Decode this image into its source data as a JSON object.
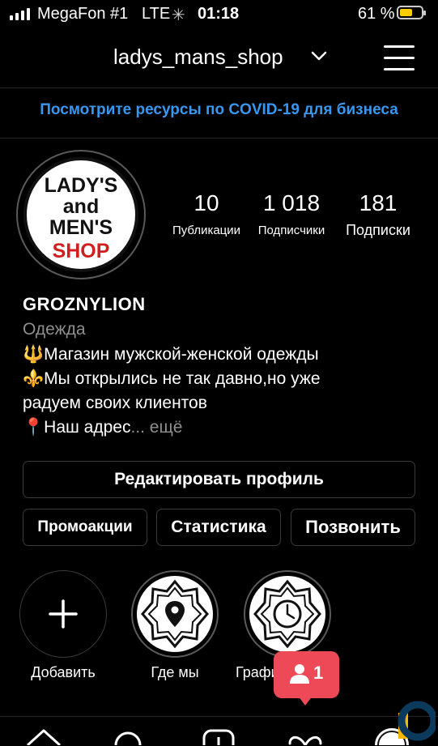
{
  "status_bar": {
    "carrier": "MegaFon #1",
    "network": "LTE",
    "time": "01:18",
    "battery_percent": "61 %",
    "battery_level": 0.61,
    "battery_color": "#ffcc00"
  },
  "header": {
    "username": "ladys_mans_shop",
    "dropdown_icon": "chevron-down-icon",
    "menu_icon": "hamburger-menu-icon"
  },
  "covid_banner": "Посмотрите ресурсы по COVID-19 для бизнеса",
  "avatar": {
    "line1": "LADY'S",
    "line2": "and",
    "line3": "MEN'S",
    "line4": "SHOP"
  },
  "stats": [
    {
      "value": "10",
      "label": "Публикации"
    },
    {
      "value": "1 018",
      "label": "Подписчики"
    },
    {
      "value": "181",
      "label": "Подписки"
    }
  ],
  "profile": {
    "name": "GROZNYLION",
    "category": "Одежда",
    "bio": [
      "🔱Магазин мужской-женской одежды",
      "⚜️Мы открылись не так давно,но уже",
      "радуем своих клиентов",
      "📍Наш адрес"
    ],
    "more": "... ещё"
  },
  "buttons": {
    "edit": "Редактировать профиль",
    "promo": "Промоакции",
    "stats": "Статистика",
    "call": "Позвонить"
  },
  "highlights": [
    {
      "label": "Добавить",
      "icon": "plus-icon"
    },
    {
      "label": "Где мы",
      "icon": "location-pin-icon"
    },
    {
      "label": "Графи",
      "icon": "clock-icon"
    }
  ],
  "notification": {
    "count": "1",
    "icon": "person-icon",
    "color": "#ed4956"
  },
  "accent_color": "#3897f0"
}
